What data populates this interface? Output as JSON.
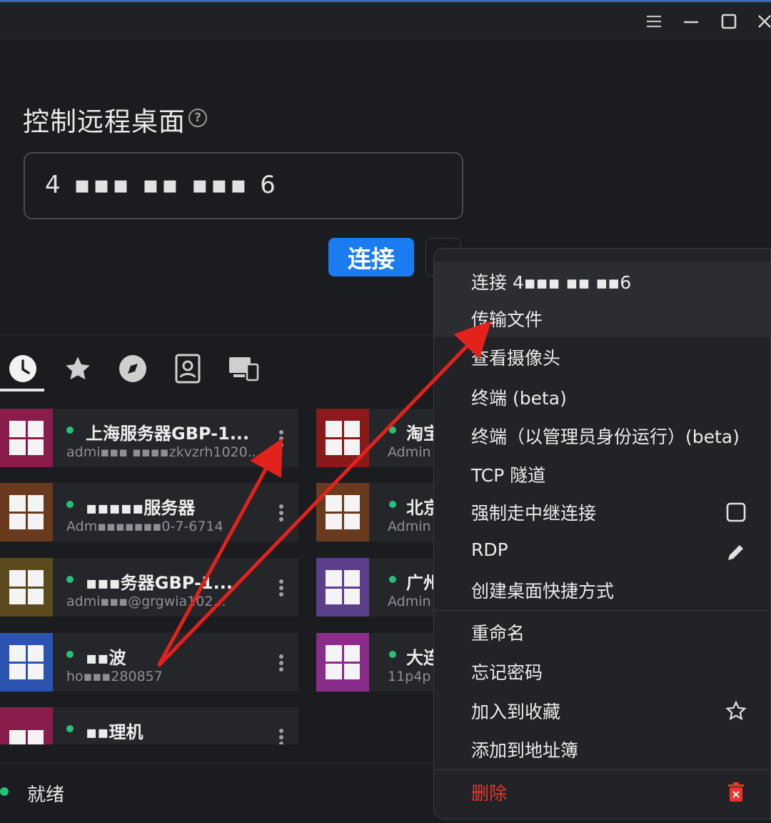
{
  "header": {
    "menu_icon": "hamburger-icon",
    "minimize_icon": "minimize-icon",
    "maximize_icon": "maximize-icon",
    "close_icon": "close-icon"
  },
  "remote": {
    "title": "控制远程桌面",
    "id_value": "4 ▪▪▪ ▪▪ ▪▪▪ 6",
    "connect_label": "连接"
  },
  "tabs": [
    {
      "name": "recent",
      "icon": "clock-icon"
    },
    {
      "name": "favorites",
      "icon": "star-icon"
    },
    {
      "name": "discovered",
      "icon": "compass-icon"
    },
    {
      "name": "address-book",
      "icon": "contact-icon"
    },
    {
      "name": "accessible-devices",
      "icon": "devices-icon"
    }
  ],
  "peers": [
    {
      "name": "上海服务器GBP-1...",
      "sub": "admi▪▪▪ ▪▪▪▪zkvzrh1020...",
      "color": "#8a1c4c"
    },
    {
      "name": "▪▪▪▪▪服务器",
      "sub": "Adm▪▪▪▪▪▪▪0-7-6714",
      "color": "#6a3a1f"
    },
    {
      "name": "▪▪▪务器GBP-1...",
      "sub": "admi▪▪▪@grgwia102...",
      "color": "#5b4a1e"
    },
    {
      "name": "▪▪波",
      "sub": "ho▪▪▪280857",
      "color": "#2b54b0"
    },
    {
      "name": "▪▪理机",
      "sub": "",
      "color": "#8a1c4c"
    },
    {
      "name": "淘宝",
      "sub": "Admin",
      "color": "#8a1a1a"
    },
    {
      "name": "北京",
      "sub": "Admin",
      "color": "#6a3a1f"
    },
    {
      "name": "广州",
      "sub": "Admin",
      "color": "#5b3f8a"
    },
    {
      "name": "大连",
      "sub": "11p4p",
      "color": "#8a2c8a"
    }
  ],
  "status": {
    "text": "就绪",
    "color": "#27c07a"
  },
  "context_menu": {
    "connect": "连接 4▪▪▪ ▪▪ ▪▪6",
    "transfer_file": "传输文件",
    "view_camera": "查看摄像头",
    "terminal": "终端 (beta)",
    "terminal_admin": "终端（以管理员身份运行）(beta)",
    "tcp_tunnel": "TCP 隧道",
    "force_relay": "强制走中继连接",
    "rdp": "RDP",
    "create_shortcut": "创建桌面快捷方式",
    "rename": "重命名",
    "forget_password": "忘记密码",
    "add_favorite": "加入到收藏",
    "add_address_book": "添加到地址簿",
    "delete": "删除",
    "delete_color": "#e8362c"
  },
  "accent_color": "#1a7cf0",
  "annotation_color": "#e3221c"
}
